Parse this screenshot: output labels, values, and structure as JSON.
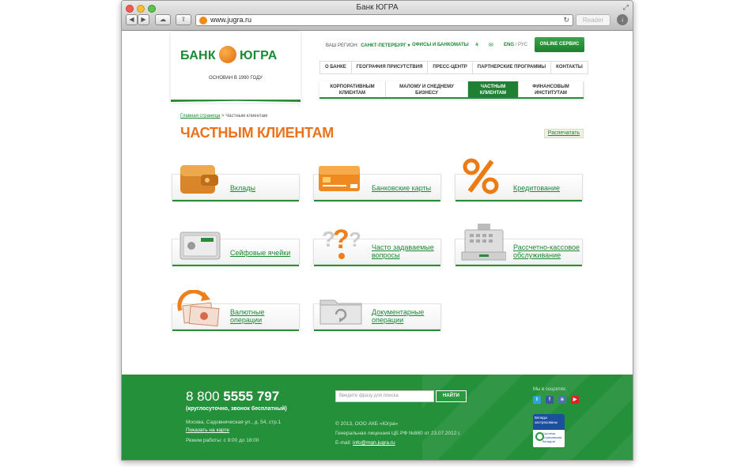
{
  "browser": {
    "title": "Банк ЮГРА",
    "url": "www.jugra.ru",
    "reader_label": "Reader",
    "back": "◀",
    "forward": "▶",
    "cloud_icon": "cloud-icon",
    "share_icon": "share-icon"
  },
  "header": {
    "logo_left": "БАНК",
    "logo_right": "ЮГРА",
    "founded": "ОСНОВАН В 1990 ГОДУ",
    "region_label": "ВАШ РЕГИОН:",
    "region_value": "САНКТ-ПЕТЕРБУРГ",
    "offices": "ОФИСЫ И БАНКОМАТЫ",
    "lang_eng": "ENG",
    "lang_sep": "/",
    "lang_rus": "РУС",
    "online_service": "ONLINE СЕРВИС"
  },
  "top_menu": [
    "О БАНКЕ",
    "ГЕОГРАФИЯ ПРИСУТСТВИЯ",
    "ПРЕСС-ЦЕНТР",
    "ПАРТНЕРСКИЕ ПРОГРАММЫ",
    "КОНТАКТЫ"
  ],
  "segment_menu": [
    {
      "line1": "КОРПОРАТИВНЫМ",
      "line2": "КЛИЕНТАМ"
    },
    {
      "line1": "МАЛОМУ И СНЕДНЕМУ",
      "line2": "БИЗНЕСУ"
    },
    {
      "line1": "ЧАСТНЫМ",
      "line2": "КЛИЕНТАМ"
    },
    {
      "line1": "ФИНАНСОВЫМ",
      "line2": "ИНСТИТУТАМ"
    }
  ],
  "breadcrumb": {
    "home": "Главная страница",
    "separator": ">",
    "current": "Частным клиентам"
  },
  "page_title": "ЧАСТНЫМ КЛИЕНТАМ",
  "print_label": "Распечатать",
  "cards": [
    {
      "line1": "Вклады",
      "line2": "",
      "icon": "wallet-icon"
    },
    {
      "line1": "Банковские карты",
      "line2": "",
      "icon": "bank-card-icon"
    },
    {
      "line1": "Кредитование",
      "line2": "",
      "icon": "percent-icon"
    },
    {
      "line1": "Сейфовые ячейки",
      "line2": "",
      "icon": "safe-icon"
    },
    {
      "line1": "Часто задаваемые",
      "line2": "вопросы",
      "icon": "question-icon"
    },
    {
      "line1": "Рассчетно-кассовое",
      "line2": "обслуживание",
      "icon": "cash-register-icon"
    },
    {
      "line1": "Валютные",
      "line2": "операции",
      "icon": "currency-icon"
    },
    {
      "line1": "Документарные",
      "line2": "операции",
      "icon": "folder-icon"
    }
  ],
  "footer": {
    "phone_prefix": "8 800",
    "phone_main": "5555 797",
    "phone_note": "(круглосуточно, звонок бесплатный)",
    "address": "Москва, Садовническая ул., д. 54, стр.1",
    "map_link": "Показать на карте",
    "hours": "Режим работы: с 9:00 до 18:00",
    "search_placeholder": "Введите фразу для поиска",
    "search_button": "НАЙТИ",
    "copyright": "© 2013, ООО АКБ «Югра»",
    "license": "Генеральная лицензия ЦБ РФ №880 от 23.07.2012 г.",
    "email_label": "E-mail:",
    "email": "info@mgn.jugra.ru",
    "social_label": "Мы в соцсетях:",
    "deposit_top": "Вклады застрахованы",
    "deposit_bottom": "Система Страхования Вкладов"
  }
}
